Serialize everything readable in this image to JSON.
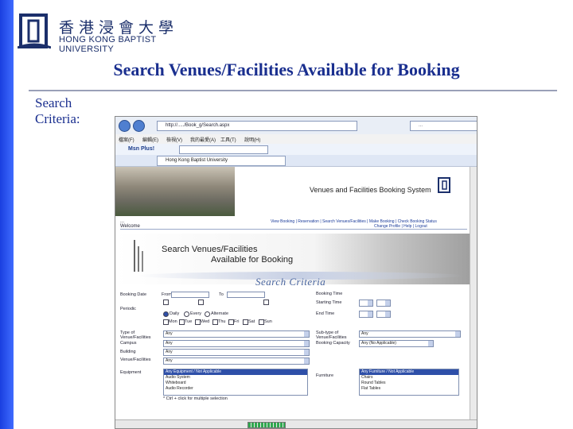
{
  "header": {
    "logo_cn": "香港浸會大學",
    "logo_en": "HONG KONG BAPTIST UNIVERSITY",
    "title": "Search Venues/Facilities Available for Booking",
    "criteria_label": "Search Criteria:"
  },
  "browser": {
    "address": "http://...../Book_g/Search.aspx",
    "search_placeholder": "...",
    "menu": [
      "檔案(F)",
      "編輯(E)",
      "檢視(V)",
      "我的最愛(A)",
      "工具(T)",
      "說明(H)"
    ],
    "messenger": "Msn Plus!",
    "tab_title": "Hong Kong Baptist University"
  },
  "page": {
    "system_name": "Venues and Facilities Booking System",
    "user_line": "...",
    "welcome": "Welcome",
    "links": "View Booking | Reservation | Search Venues/Facilities | Make Booking | Check Booking Status",
    "links2": "Change Profile | Help | Logout",
    "svf_line1": "Search Venues/Facilities",
    "svf_line2": "Available for Booking",
    "search_criteria": "Search Criteria"
  },
  "form": {
    "booking_date": "Booking Date",
    "from": "From",
    "to": "To",
    "booking_time": "Booking Time",
    "starting_time": "Starting Time",
    "end_time": "End Time",
    "periodic": "Periodic",
    "daily": "Daily",
    "every": "Every",
    "alternate": "Alternate",
    "days": [
      "Mon",
      "Tue",
      "Wed",
      "Thu",
      "Fri",
      "Sat",
      "Sun"
    ],
    "type_label": "Type of Venue/Facilities",
    "type_value": "Any",
    "campus_label": "Campus",
    "campus_value": "Any",
    "building_label": "Building",
    "building_value": "Any",
    "venue_label": "Venue/Facilities",
    "venue_value": "Any",
    "subtype_label": "Sub-type of Venue/Facilities",
    "subtype_value": "Any",
    "capacity_label": "Booking Capacity",
    "capacity_value": "Any (No Applicable)",
    "equipment_label": "Equipment",
    "equipment_items": [
      "Any Equipment / Not Applicable",
      "Audio System",
      "Whiteboard",
      "Audio Recorder"
    ],
    "equipment_note": "* Ctrl + click for multiple selection",
    "furniture_label": "Furniture",
    "furniture_items": [
      "Any Furniture / Not Applicable",
      "Chairs",
      "Round Tables",
      "Flat Tables"
    ]
  }
}
